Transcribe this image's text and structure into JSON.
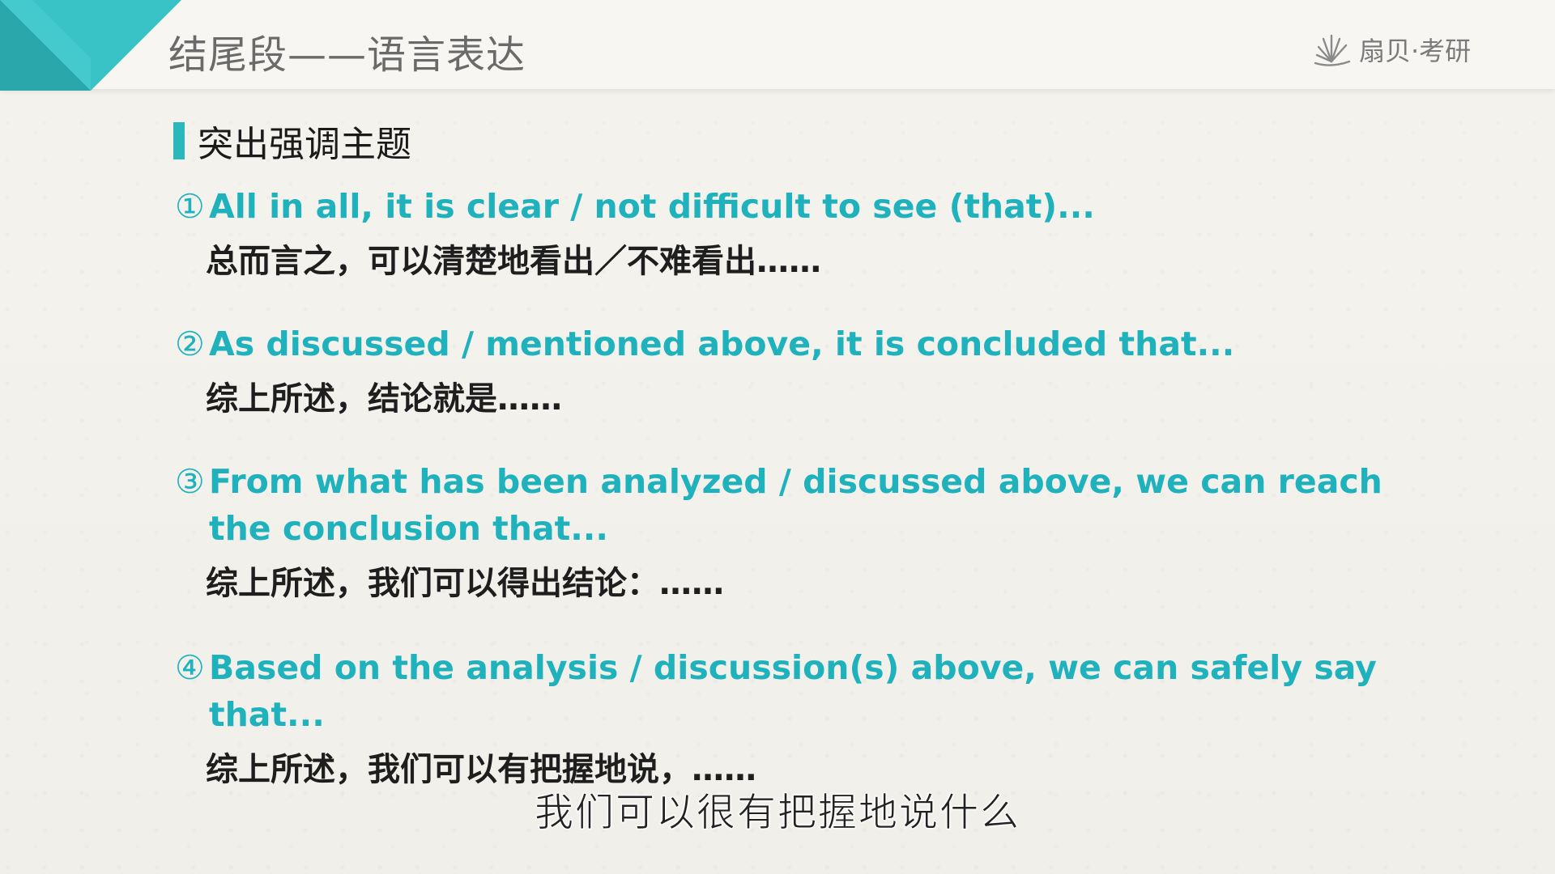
{
  "header": {
    "title": "结尾段——语言表达",
    "brand": "扇贝·考研",
    "accent_color": "#2bb8ba",
    "brand_icon": "sunburst-logo-icon"
  },
  "section": {
    "title": "突出强调主题"
  },
  "items": [
    {
      "num": "①",
      "en": "All in all, it is clear / not difficult to see (that)...",
      "zh": "总而言之，可以清楚地看出／不难看出……"
    },
    {
      "num": "②",
      "en": "As discussed / mentioned above, it is concluded that...",
      "zh": "综上所述，结论就是……"
    },
    {
      "num": "③",
      "en": "From what has been analyzed / discussed above, we can reach the conclusion that...",
      "zh": "综上所述，我们可以得出结论：……"
    },
    {
      "num": "④",
      "en": "Based on the analysis / discussion(s) above, we can safely say that...",
      "zh": "综上所述，我们可以有把握地说，……"
    }
  ],
  "subtitle": "我们可以很有把握地说什么",
  "colors": {
    "english_text": "#1fb2bd",
    "chinese_text": "#1e1e1e",
    "background": "#f3f1ec"
  }
}
